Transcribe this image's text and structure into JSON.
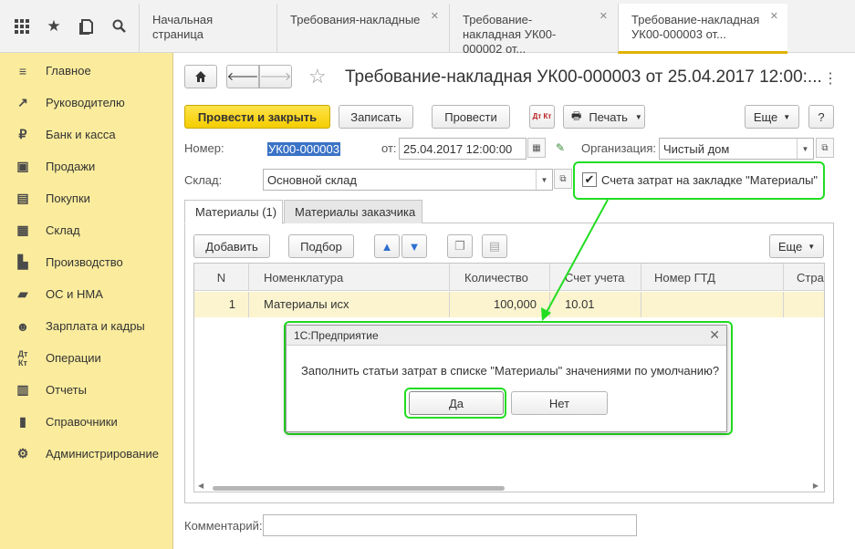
{
  "tabs": [
    {
      "label": "Начальная страница"
    },
    {
      "label": "Требования-накладные"
    },
    {
      "label": "Требование-накладная УК00-000002 от..."
    },
    {
      "label": "Требование-накладная УК00-000003 от..."
    }
  ],
  "sidebar": {
    "items": [
      {
        "label": "Главное",
        "icon": "menu-lines-icon"
      },
      {
        "label": "Руководителю",
        "icon": "trend-icon"
      },
      {
        "label": "Банк и касса",
        "icon": "ruble-coin-icon"
      },
      {
        "label": "Продажи",
        "icon": "bag-icon"
      },
      {
        "label": "Покупки",
        "icon": "cart-icon"
      },
      {
        "label": "Склад",
        "icon": "warehouse-icon"
      },
      {
        "label": "Производство",
        "icon": "factory-icon"
      },
      {
        "label": "ОС и НМА",
        "icon": "truck-icon"
      },
      {
        "label": "Зарплата и кадры",
        "icon": "people-icon"
      },
      {
        "label": "Операции",
        "icon": "dt-kt-icon"
      },
      {
        "label": "Отчеты",
        "icon": "bar-chart-icon"
      },
      {
        "label": "Справочники",
        "icon": "book-icon"
      },
      {
        "label": "Администрирование",
        "icon": "gear-icon"
      }
    ]
  },
  "document": {
    "title": "Требование-накладная УК00-000003 от 25.04.2017 12:00:..."
  },
  "toolbar": {
    "post_close": "Провести и закрыть",
    "write": "Записать",
    "post": "Провести",
    "dtkt": "Дт Кт",
    "print": "Печать",
    "more": "Еще",
    "help": "?"
  },
  "fields": {
    "number_label": "Номер:",
    "number_value": "УК00-000003",
    "date_label": "от:",
    "date_value": "25.04.2017 12:00:00",
    "org_label": "Организация:",
    "org_value": "Чистый дом",
    "warehouse_label": "Склад:",
    "warehouse_value": "Основной склад",
    "cost_accounts_checkbox": "Счета затрат на закладке \"Материалы\"",
    "cost_accounts_checked": true,
    "comment_label": "Комментарий:",
    "comment_value": ""
  },
  "form_tabs": [
    {
      "label": "Материалы (1)",
      "active": true
    },
    {
      "label": "Материалы заказчика",
      "active": false
    }
  ],
  "table_toolbar": {
    "add": "Добавить",
    "pick": "Подбор",
    "more": "Еще"
  },
  "table": {
    "columns": [
      "N",
      "Номенклатура",
      "Количество",
      "Счет учета",
      "Номер ГТД",
      "Стра"
    ],
    "rows": [
      [
        "1",
        "Материалы исх",
        "100,000",
        "10.01",
        "",
        ""
      ]
    ]
  },
  "dialog": {
    "title": "1С:Предприятие",
    "message": "Заполнить статьи затрат в списке \"Материалы\" значениями по умолчанию?",
    "yes": "Да",
    "no": "Нет"
  },
  "colors": {
    "highlight": "#22dd22",
    "sidebar_bg": "#fbec9d",
    "primary_button": "#f4cd00"
  }
}
